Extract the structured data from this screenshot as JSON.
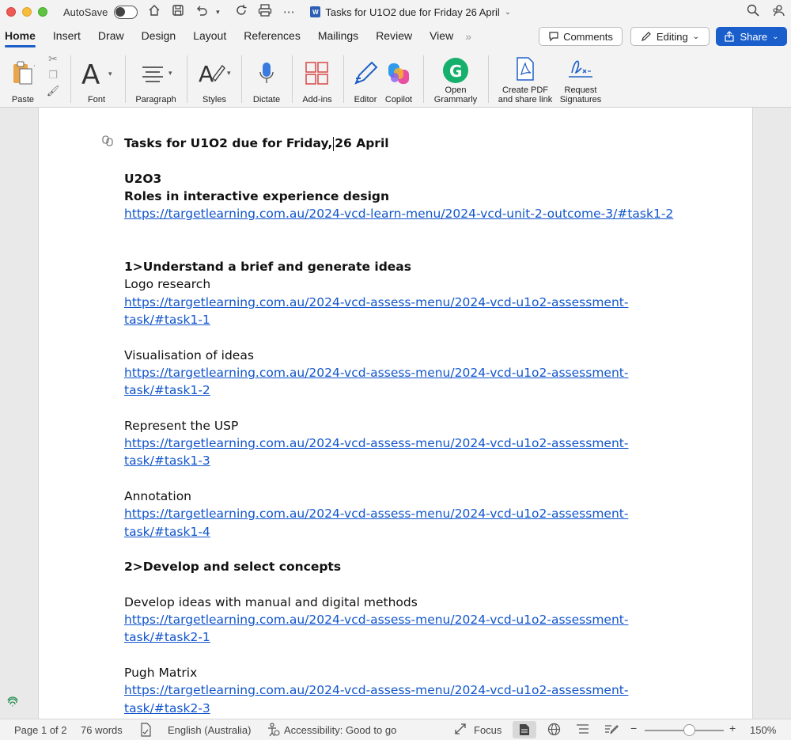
{
  "titlebar": {
    "autosave_label": "AutoSave",
    "doc_title": "Tasks for U1O2 due for Friday 26 April"
  },
  "tabs": [
    "Home",
    "Insert",
    "Draw",
    "Design",
    "Layout",
    "References",
    "Mailings",
    "Review",
    "View"
  ],
  "header_buttons": {
    "comments": "Comments",
    "editing": "Editing",
    "share": "Share"
  },
  "ribbon": {
    "paste": "Paste",
    "font": "Font",
    "paragraph": "Paragraph",
    "styles": "Styles",
    "dictate": "Dictate",
    "addins": "Add-ins",
    "editor": "Editor",
    "copilot": "Copilot",
    "grammarly_1": "Open",
    "grammarly_2": "Grammarly",
    "pdf_1": "Create PDF",
    "pdf_2": "and share link",
    "sig_1": "Request",
    "sig_2": "Signatures"
  },
  "document": {
    "title_part1": "Tasks for U1O2 due for Friday,",
    "title_part2": "26 April",
    "u2o3": "U2O3",
    "roles": "Roles in interactive experience design",
    "roles_link": "https://targetlearning.com.au/2024-vcd-learn-menu/2024-vcd-unit-2-outcome-3/#task1-2",
    "section1": "1>Understand a brief and generate ideas",
    "items1": [
      {
        "label": "Logo research",
        "link1": "https://targetlearning.com.au/2024-vcd-assess-menu/2024-vcd-u1o2-assessment-",
        "link2": "task/#task1-1"
      },
      {
        "label": "Visualisation of ideas",
        "link1": "https://targetlearning.com.au/2024-vcd-assess-menu/2024-vcd-u1o2-assessment-",
        "link2": "task/#task1-2"
      },
      {
        "label": "Represent the USP",
        "link1": "https://targetlearning.com.au/2024-vcd-assess-menu/2024-vcd-u1o2-assessment-",
        "link2": "task/#task1-3"
      },
      {
        "label": "Annotation",
        "link1": "https://targetlearning.com.au/2024-vcd-assess-menu/2024-vcd-u1o2-assessment-",
        "link2": "task/#task1-4"
      }
    ],
    "section2": "2>Develop and select concepts",
    "items2": [
      {
        "label": "Develop ideas with manual and digital methods",
        "link1": "https://targetlearning.com.au/2024-vcd-assess-menu/2024-vcd-u1o2-assessment-",
        "link2": "task/#task2-1"
      },
      {
        "label": "Pugh Matrix",
        "link1": "https://targetlearning.com.au/2024-vcd-assess-menu/2024-vcd-u1o2-assessment-",
        "link2": "task/#task2-3"
      }
    ]
  },
  "statusbar": {
    "page": "Page 1 of 2",
    "words": "76 words",
    "language": "English (Australia)",
    "accessibility": "Accessibility: Good to go",
    "focus": "Focus",
    "zoom": "150%",
    "zoom_minus": "−",
    "zoom_plus": "+"
  },
  "colors": {
    "accent": "#1a5ecb",
    "link": "#1155cc"
  }
}
